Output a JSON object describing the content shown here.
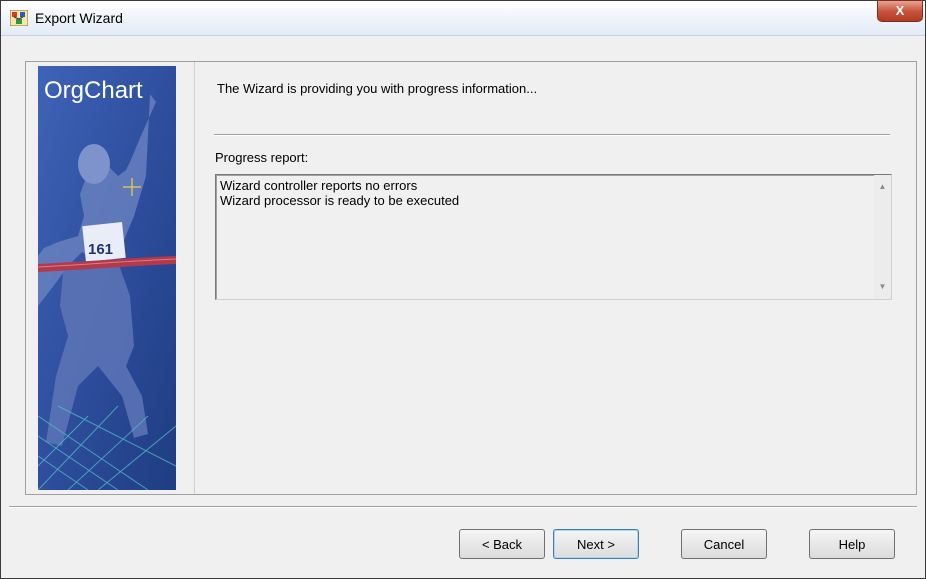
{
  "window": {
    "title": "Export Wizard",
    "close_label": "X",
    "app_icon": "orgchart-app-icon"
  },
  "banner": {
    "brand": "OrgChart",
    "bib_number": "161"
  },
  "main": {
    "header": "The Wizard is providing you with progress information...",
    "progress_label": "Progress report:",
    "log_lines": [
      "Wizard controller reports no errors",
      "Wizard processor is ready to be executed"
    ]
  },
  "buttons": {
    "back": "< Back",
    "next": "Next >",
    "cancel": "Cancel",
    "help": "Help"
  },
  "colors": {
    "banner_blue": "#2f4f9e",
    "close_red": "#c9543d"
  }
}
